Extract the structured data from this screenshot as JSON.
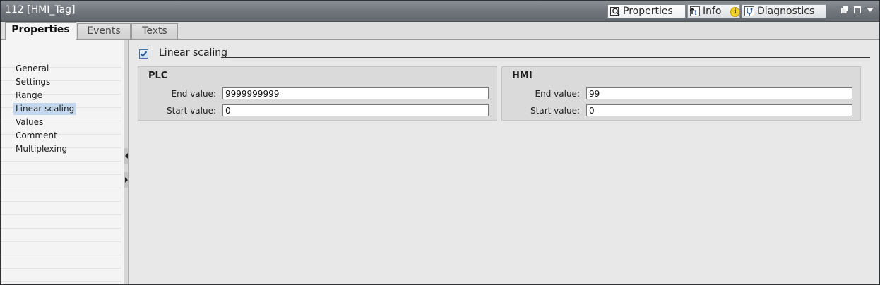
{
  "window": {
    "title": "112 [HMI_Tag]"
  },
  "inspector_tabs": [
    {
      "label": "Properties",
      "icon": "properties-icon"
    },
    {
      "label": "Info",
      "icon": "info-icon",
      "badge": "i"
    },
    {
      "label": "Diagnostics",
      "icon": "diagnostics-icon"
    }
  ],
  "tabs": [
    {
      "label": "Properties"
    },
    {
      "label": "Events"
    },
    {
      "label": "Texts"
    }
  ],
  "sidebar": {
    "items": [
      {
        "label": "General"
      },
      {
        "label": "Settings"
      },
      {
        "label": "Range"
      },
      {
        "label": "Linear scaling"
      },
      {
        "label": "Values"
      },
      {
        "label": "Comment"
      },
      {
        "label": "Multiplexing"
      }
    ],
    "selected": "Linear scaling"
  },
  "linear_scaling": {
    "checkbox_label": "Linear scaling",
    "checked": true,
    "plc": {
      "title": "PLC",
      "end_label": "End value:",
      "end_value": "9999999999",
      "start_label": "Start value:",
      "start_value": "0"
    },
    "hmi": {
      "title": "HMI",
      "end_label": "End value:",
      "end_value": "99",
      "start_label": "Start value:",
      "start_value": "0"
    }
  },
  "colors": {
    "selection": "#c3d8ee",
    "titlebar": "#6f757b",
    "checkbox_check": "#2b5d9a"
  }
}
